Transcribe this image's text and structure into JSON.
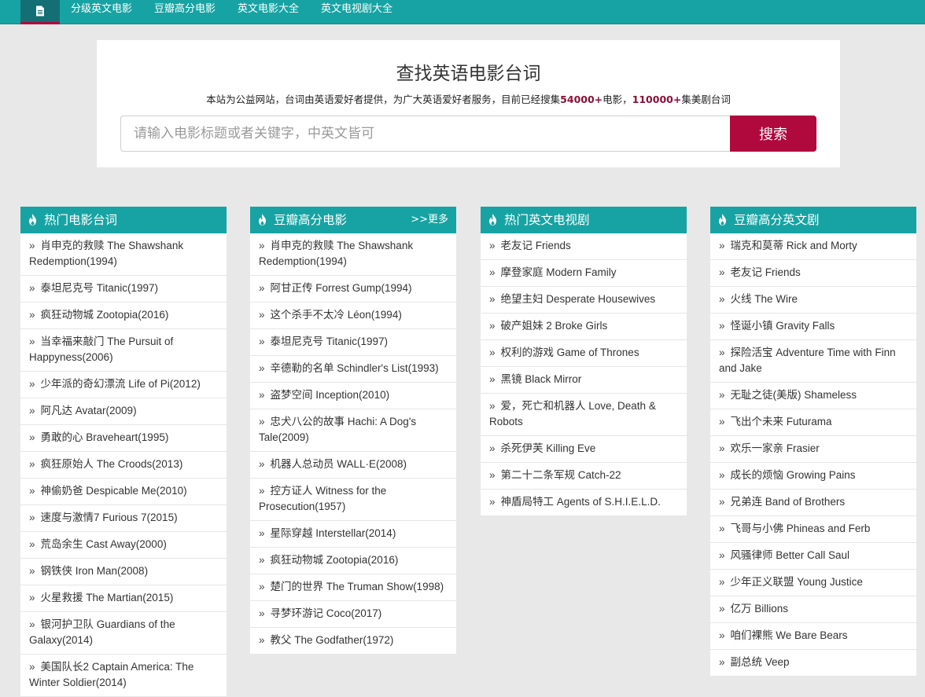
{
  "nav": {
    "logo_icon": "document-icon",
    "links": [
      "分级英文电影",
      "豆瓣高分电影",
      "英文电影大全",
      "英文电视剧大全"
    ]
  },
  "search": {
    "title": "查找英语电影台词",
    "sub_prefix": "本站为公益网站，台词由英语爱好者提供，为广大英语爱好者服务，目前已经搜集",
    "movies_count": "54000+",
    "sub_mid": "电影，",
    "episodes_count": "110000+",
    "sub_suffix": "集美剧台词",
    "placeholder": "请输入电影标题或者关键字，中英文皆可",
    "value": "",
    "button_label": "搜索"
  },
  "colors": {
    "teal": "#17a3a3",
    "accent": "#b0093e"
  },
  "arrow": "»",
  "columns": [
    {
      "title": "热门电影台词",
      "more": "",
      "items": [
        "肖申克的救赎 The Shawshank Redemption(1994)",
        "泰坦尼克号 Titanic(1997)",
        "疯狂动物城 Zootopia(2016)",
        "当幸福来敲门 The Pursuit of Happyness(2006)",
        "少年派的奇幻漂流 Life of Pi(2012)",
        "阿凡达 Avatar(2009)",
        "勇敢的心 Braveheart(1995)",
        "疯狂原始人 The Croods(2013)",
        "神偷奶爸 Despicable Me(2010)",
        "速度与激情7 Furious 7(2015)",
        "荒岛余生 Cast Away(2000)",
        "钢铁侠 Iron Man(2008)",
        "火星救援 The Martian(2015)",
        "银河护卫队 Guardians of the Galaxy(2014)",
        "美国队长2 Captain America: The Winter Soldier(2014)"
      ]
    },
    {
      "title": "豆瓣高分电影",
      "more": ">>更多",
      "items": [
        "肖申克的救赎 The Shawshank Redemption(1994)",
        "阿甘正传 Forrest Gump(1994)",
        "这个杀手不太冷 Léon(1994)",
        "泰坦尼克号 Titanic(1997)",
        "辛德勒的名单 Schindler's List(1993)",
        "盗梦空间 Inception(2010)",
        "忠犬八公的故事 Hachi: A Dog's Tale(2009)",
        "机器人总动员 WALL·E(2008)",
        "控方证人 Witness for the Prosecution(1957)",
        "星际穿越 Interstellar(2014)",
        "疯狂动物城 Zootopia(2016)",
        "楚门的世界 The Truman Show(1998)",
        "寻梦环游记 Coco(2017)",
        "教父 The Godfather(1972)"
      ]
    },
    {
      "title": "热门英文电视剧",
      "more": "",
      "items": [
        "老友记 Friends",
        "摩登家庭 Modern Family",
        "绝望主妇 Desperate Housewives",
        "破产姐妹 2 Broke Girls",
        "权利的游戏 Game of Thrones",
        "黑镜 Black Mirror",
        "爱，死亡和机器人 Love, Death & Robots",
        "杀死伊芙 Killing Eve",
        "第二十二条军规 Catch-22",
        "神盾局特工 Agents of S.H.I.E.L.D."
      ]
    },
    {
      "title": "豆瓣高分英文剧",
      "more": "",
      "items": [
        "瑞克和莫蒂 Rick and Morty",
        "老友记 Friends",
        "火线 The Wire",
        "怪诞小镇 Gravity Falls",
        "探险活宝 Adventure Time with Finn and Jake",
        "无耻之徒(美版) Shameless",
        "飞出个未来 Futurama",
        "欢乐一家亲 Frasier",
        "成长的烦恼 Growing Pains",
        "兄弟连 Band of Brothers",
        "飞哥与小佛 Phineas and Ferb",
        "风骚律师 Better Call Saul",
        "少年正义联盟 Young Justice",
        "亿万 Billions",
        "咱们裸熊 We Bare Bears",
        "副总统 Veep"
      ]
    }
  ]
}
